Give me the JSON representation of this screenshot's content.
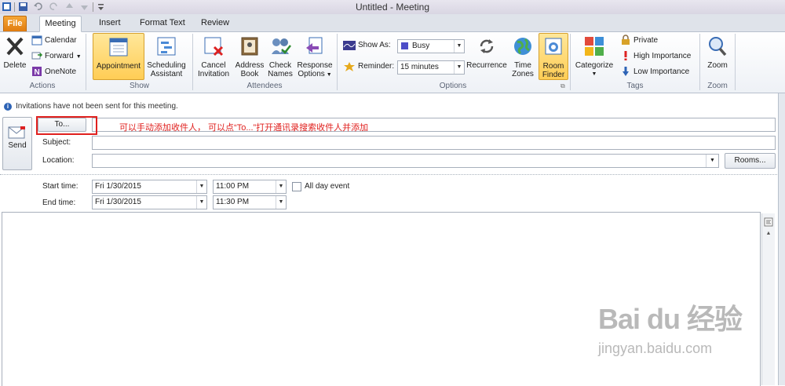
{
  "window": {
    "title": "Untitled - Meeting"
  },
  "tabs": [
    {
      "label": "File"
    },
    {
      "label": "Meeting"
    },
    {
      "label": "Insert"
    },
    {
      "label": "Format Text"
    },
    {
      "label": "Review"
    }
  ],
  "ribbon": {
    "actions": {
      "label": "Actions",
      "delete": "Delete",
      "calendar": "Calendar",
      "forward": "Forward",
      "onenote": "OneNote"
    },
    "show": {
      "label": "Show",
      "appointment": "Appointment",
      "scheduling_1": "Scheduling",
      "scheduling_2": "Assistant"
    },
    "attendees": {
      "label": "Attendees",
      "cancel_1": "Cancel",
      "cancel_2": "Invitation",
      "address_1": "Address",
      "address_2": "Book",
      "check_1": "Check",
      "check_2": "Names",
      "response_1": "Response",
      "response_2": "Options"
    },
    "options": {
      "label": "Options",
      "show_as_label": "Show As:",
      "show_as_value": "Busy",
      "reminder_label": "Reminder:",
      "reminder_value": "15 minutes",
      "recurrence": "Recurrence",
      "timezones_1": "Time",
      "timezones_2": "Zones",
      "roomfinder_1": "Room",
      "roomfinder_2": "Finder"
    },
    "tags": {
      "label": "Tags",
      "categorize": "Categorize",
      "private": "Private",
      "high": "High Importance",
      "low": "Low Importance"
    },
    "zoom": {
      "label": "Zoom",
      "zoom": "Zoom"
    }
  },
  "infobar": {
    "text": "Invitations have not been sent for this meeting."
  },
  "form": {
    "send": "Send",
    "to_button": "To...",
    "to_value": "",
    "subject_label": "Subject:",
    "subject_value": "",
    "location_label": "Location:",
    "location_value": "",
    "rooms_button": "Rooms...",
    "start_label": "Start time:",
    "start_date": "Fri 1/30/2015",
    "start_time": "11:00 PM",
    "end_label": "End time:",
    "end_date": "Fri 1/30/2015",
    "end_time": "11:30 PM",
    "all_day": "All day event"
  },
  "annotation": {
    "text": "可以手动添加收件人， 可以点“To...”打开通讯录搜索收件人并添加"
  },
  "watermark": {
    "brand": "Bai du 经验",
    "url": "jingyan.baidu.com"
  },
  "colors": {
    "accent": "#2d63b5",
    "file_tab": "#e07c10",
    "highlight": "#ffcd55",
    "annotation": "#e0201e"
  }
}
